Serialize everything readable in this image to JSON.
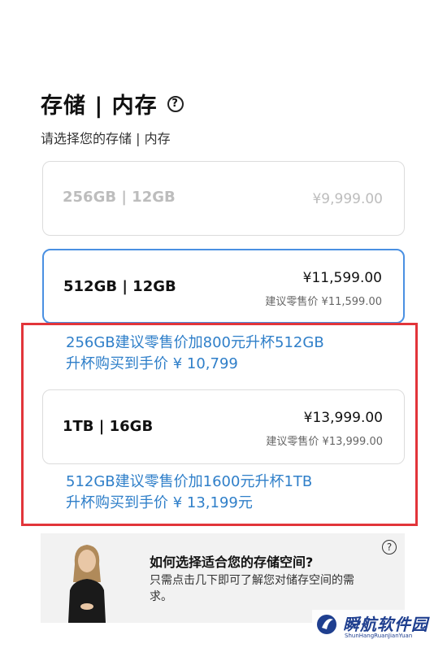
{
  "header": {
    "title": "存储 | 内存",
    "help_glyph": "?",
    "subtitle": "请选择您的存储 | 内存"
  },
  "options": [
    {
      "name": "256GB | 12GB",
      "price": "¥9,999.00",
      "retail": "",
      "state": "disabled"
    },
    {
      "name": "512GB | 12GB",
      "price": "¥11,599.00",
      "retail": "建议零售价 ¥11,599.00",
      "state": "selected"
    },
    {
      "name": "1TB | 16GB",
      "price": "¥13,999.00",
      "retail": "建议零售价 ¥13,999.00",
      "state": "available"
    }
  ],
  "promos": [
    {
      "line1": "256GB建议零售价加800元升杯512GB",
      "line2": "升杯购买到手价 ¥ 10,799"
    },
    {
      "line1": "512GB建议零售价加1600元升杯1TB",
      "line2": "升杯购买到手价 ¥ 13,199元"
    }
  ],
  "guide": {
    "title": "如何选择适合您的存储空间?",
    "description": "只需点击几下即可了解您对储存空间的需求。",
    "help_glyph": "?"
  },
  "watermark": {
    "name": "瞬航软件园",
    "subtext": "ShunHangRuanJianYuan"
  },
  "colors": {
    "accent_blue": "#4a90e2",
    "promo_text": "#2f7fc9",
    "highlight_frame": "#e2353a"
  }
}
